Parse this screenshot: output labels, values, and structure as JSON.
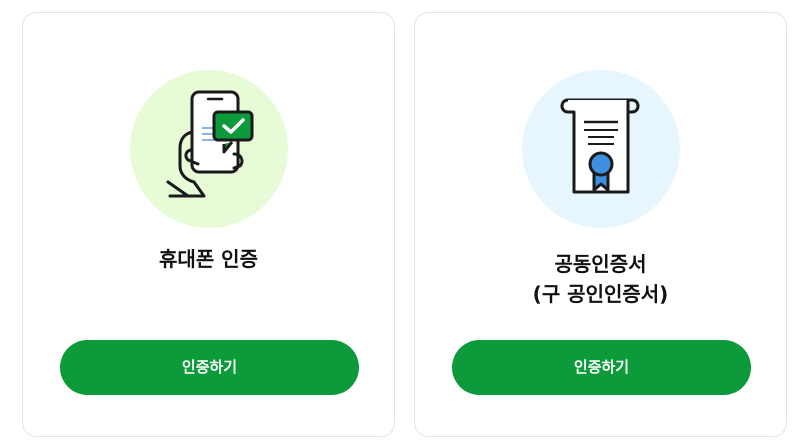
{
  "cards": [
    {
      "icon": "phone-check-icon",
      "circle_color": "#e6fbd6",
      "title": "휴대폰 인증",
      "button_label": "인증하기"
    },
    {
      "icon": "certificate-icon",
      "circle_color": "#e7f6fd",
      "title": "공동인증서",
      "subtitle": "(구 공인인증서)",
      "button_label": "인증하기"
    }
  ],
  "colors": {
    "button_bg": "#0d9a3a",
    "button_text": "#ffffff",
    "card_border": "#e3e3e3",
    "check_bubble": "#0d9a3a",
    "ribbon_blue": "#3d8fe0"
  }
}
